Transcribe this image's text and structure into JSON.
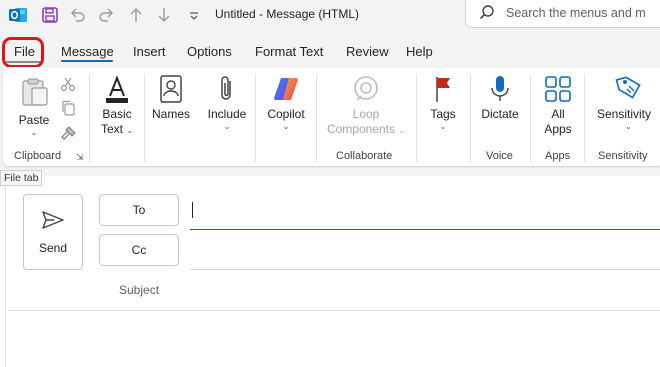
{
  "titlebar": {
    "title": "Untitled  -  Message (HTML)",
    "search_placeholder": "Search the menus and m",
    "icons": [
      "outlook-icon",
      "save-icon",
      "undo-icon",
      "redo-icon",
      "previous-item-icon",
      "next-item-icon",
      "customize-toolbar-icon",
      "search-icon"
    ]
  },
  "tabs": [
    {
      "label": "File",
      "name": "tab-file"
    },
    {
      "label": "Message",
      "name": "tab-message",
      "active": true
    },
    {
      "label": "Insert",
      "name": "tab-insert"
    },
    {
      "label": "Options",
      "name": "tab-options"
    },
    {
      "label": "Format Text",
      "name": "tab-format-text"
    },
    {
      "label": "Review",
      "name": "tab-review"
    },
    {
      "label": "Help",
      "name": "tab-help"
    }
  ],
  "ribbon": {
    "paste": "Paste",
    "basic_text": [
      "Basic",
      "Text"
    ],
    "names": "Names",
    "include": "Include",
    "copilot": "Copilot",
    "loop_components": [
      "Loop",
      "Components"
    ],
    "tags": "Tags",
    "dictate": "Dictate",
    "all_apps": [
      "All",
      "Apps"
    ],
    "sensitivity": "Sensitivity",
    "groups": {
      "clipboard": "Clipboard",
      "collaborate": "Collaborate",
      "voice": "Voice",
      "apps": "Apps",
      "sensitivity": "Sensitivity"
    }
  },
  "tooltip": "File tab",
  "compose": {
    "send": "Send",
    "to": "To",
    "cc": "Cc",
    "subject": "Subject",
    "to_value": "",
    "cc_value": ""
  },
  "colors": {
    "accent": "#0f6cbd",
    "highlight_outline": "#e0141e",
    "outlook_blue": "#0f6cbd",
    "save_purple": "#8b3fbf",
    "tags_red": "#c42b1c"
  }
}
